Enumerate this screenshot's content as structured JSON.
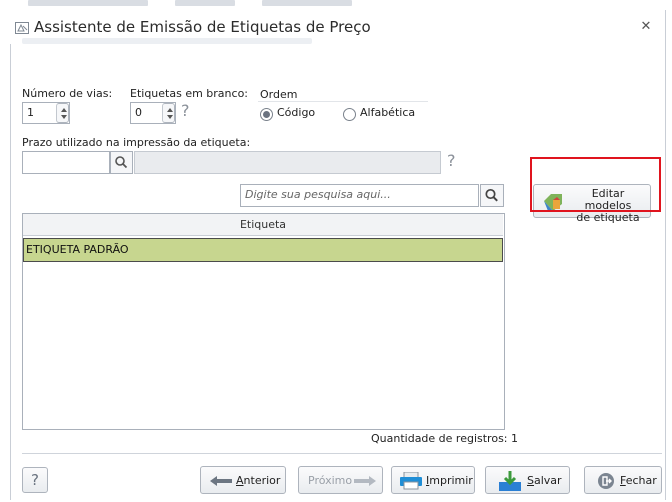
{
  "window": {
    "title": "Assistente de Emissão de Etiquetas de Preço",
    "close_glyph": "✕"
  },
  "options": {
    "vias_label": "Número de vias:",
    "vias_value": "1",
    "branco_label": "Etiquetas em branco:",
    "branco_value": "0",
    "help_glyph": "?",
    "ordem_label": "Ordem",
    "ordem_codigo": "Código",
    "ordem_alfabetica": "Alfabética",
    "ordem_selected": "Código"
  },
  "prazo": {
    "label": "Prazo utilizado na impressão da etiqueta:",
    "code_value": "",
    "description_value": "",
    "help_glyph": "?"
  },
  "search": {
    "placeholder": "Digite sua pesquisa aqui..."
  },
  "grid": {
    "column_header": "Etiqueta",
    "rows": [
      {
        "etiqueta": "ETIQUETA PADRÃO",
        "selected": true
      }
    ],
    "count_label": "Quantidade de registros: 1"
  },
  "side": {
    "edit_models_line1": "Editar modelos",
    "edit_models_line2": "de etiqueta",
    "highlight_color": "#e0141e"
  },
  "footer": {
    "help_glyph": "?",
    "anterior_u": "A",
    "anterior_rest": "nterior",
    "proximo": "Próximo",
    "imprimir_u": "I",
    "imprimir_rest": "mprimir",
    "salvar_u": "S",
    "salvar_rest": "alvar",
    "fechar_u": "F",
    "fechar_rest": "echar"
  },
  "colors": {
    "selected_row": "#c7d68f",
    "border": "#a9b0ba"
  },
  "icons": {
    "title": "wizard-icon",
    "search": "search-icon",
    "edit_models": "edit-models-icon",
    "anterior": "arrow-left-icon",
    "proximo": "arrow-right-icon",
    "imprimir": "printer-icon",
    "salvar": "download-save-icon",
    "fechar": "exit-icon"
  }
}
